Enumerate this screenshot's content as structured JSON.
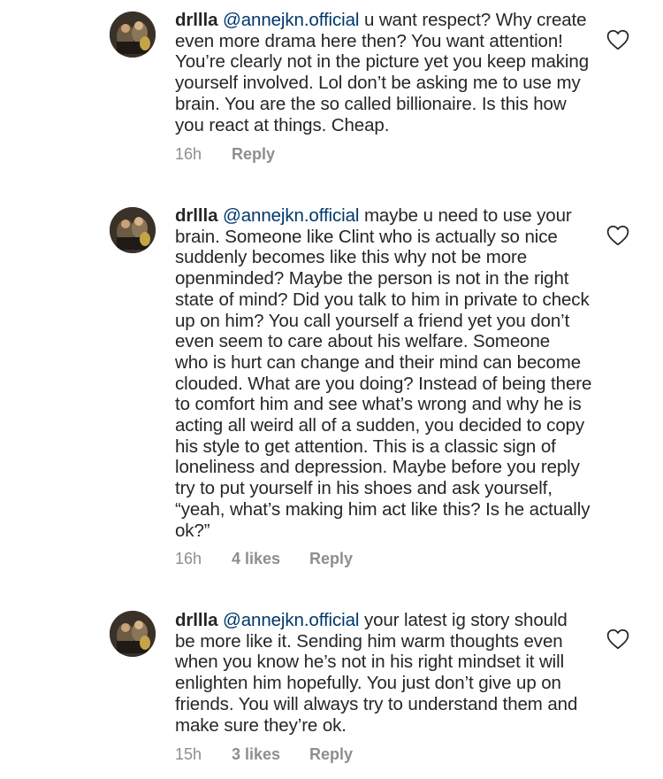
{
  "comments": [
    {
      "username": "drllla",
      "mention": "@annejkn.official",
      "lines": [
        " u want respect? Why create",
        "even more drama here then? You want attention!",
        "You’re clearly not in the picture yet you keep making",
        "yourself involved. Lol don’t be asking me to use my",
        "brain. You are the so called billionaire. Is this how",
        "you react at things. Cheap."
      ],
      "time": "16h",
      "likes": "",
      "reply": "Reply",
      "icons": {
        "like": "heart-outline-icon",
        "avatar": "profile-avatar"
      }
    },
    {
      "username": "drllla",
      "mention": "@annejkn.official",
      "lines": [
        " maybe u need to use your",
        "brain. Someone like Clint who is actually so nice",
        "suddenly becomes like this why not be more",
        "openminded? Maybe the person is not in the right",
        "state of mind? Did you talk to him in private to check",
        "up on him? You call yourself a friend yet you don’t",
        "even seem to care about his welfare. Someone",
        "who is hurt can change and their mind can become",
        "clouded. What are you doing? Instead of being there",
        "to comfort him and see what’s wrong and why he is",
        "acting all weird all of a sudden, you decided to copy",
        "his style to get attention. This is a classic sign of",
        "loneliness and depression. Maybe before you reply",
        "try to put yourself in his shoes and ask yourself,",
        "“yeah, what’s making him act like this? Is he actually",
        "ok?”"
      ],
      "time": "16h",
      "likes": "4 likes",
      "reply": "Reply",
      "icons": {
        "like": "heart-outline-icon",
        "avatar": "profile-avatar"
      }
    },
    {
      "username": "drllla",
      "mention": "@annejkn.official",
      "lines": [
        " your latest ig story should",
        "be more like it. Sending him warm thoughts even",
        "when you know he’s not in his right mindset it will",
        "enlighten him hopefully. You just don’t give up on",
        "friends. You will always try to understand them and",
        "make sure they’re ok."
      ],
      "time": "15h",
      "likes": "3 likes",
      "reply": "Reply",
      "icons": {
        "like": "heart-outline-icon",
        "avatar": "profile-avatar"
      }
    }
  ],
  "colors": {
    "text": "#262626",
    "mention": "#00376b",
    "meta": "#8e8e8e"
  }
}
